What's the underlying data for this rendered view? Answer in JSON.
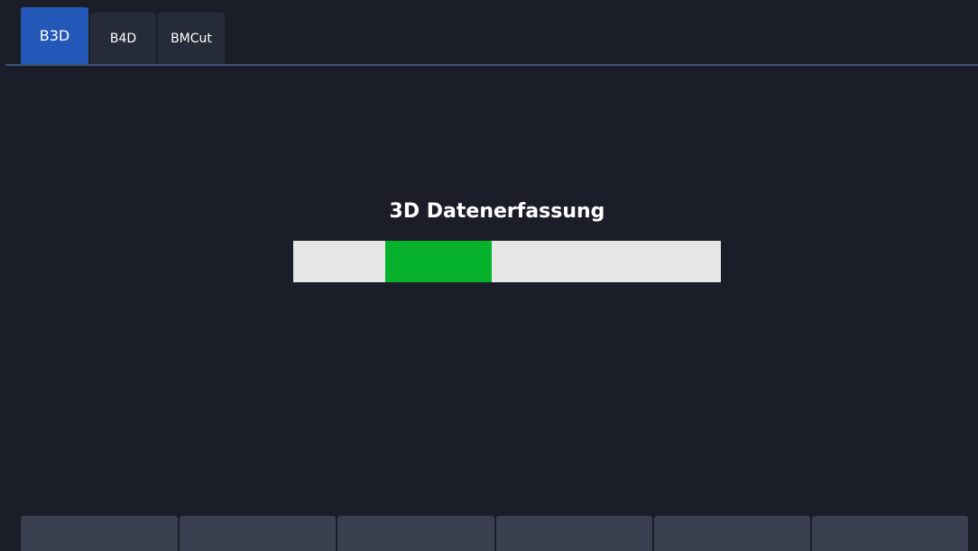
{
  "tabs": [
    {
      "label": "B3D",
      "active": true
    },
    {
      "label": "B4D",
      "active": false
    },
    {
      "label": "BMCut",
      "active": false
    }
  ],
  "acquisition": {
    "title": "3D Datenerfassung",
    "progress_start_fraction": 0.215,
    "progress_end_fraction": 0.464
  },
  "softkeys": [
    {
      "label": ""
    },
    {
      "label": ""
    },
    {
      "label": ""
    },
    {
      "label": ""
    },
    {
      "label": ""
    },
    {
      "label": ""
    }
  ],
  "colors": {
    "background": "#1b1e28",
    "active_tab": "#2458b8",
    "inactive_tab": "#262b3a",
    "progress_track": "#e6e6e6",
    "progress_fill": "#06b22c",
    "softkey": "#3b4050"
  }
}
